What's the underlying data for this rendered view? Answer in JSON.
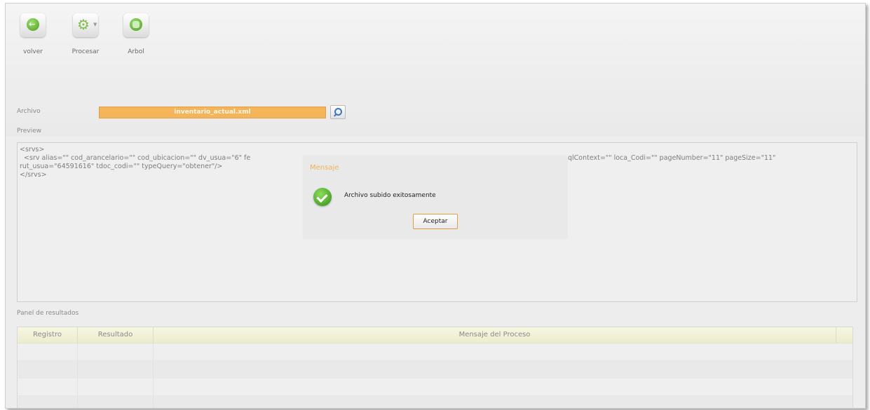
{
  "toolbar": {
    "back_label": "volver",
    "process_label": "Procesar",
    "tree_label": "Arbol"
  },
  "form": {
    "file_label": "Archivo",
    "file_value": "inventario_actual.xml",
    "preview_label": "Preview"
  },
  "preview": {
    "lines": [
      "<srvs>",
      "  <srv alias=\"\" cod_arancelario=\"\" cod_ubicacion=\"\" dv_usua=\"6\" fe",
      "rut_usua=\"64591616\" tdoc_codi=\"\" typeQuery=\"obtener\"/>",
      "</srvs>"
    ],
    "line2_tail": "qlContext=\"\" loca_Codi=\"\" pageNumber=\"11\" pageSize=\"11\""
  },
  "results": {
    "panel_label": "Panel de resultados",
    "columns": [
      "Registro",
      "Resultado",
      "Mensaje del Proceso"
    ]
  },
  "dialog": {
    "title": "Mensaje",
    "message": "Archivo subido exitosamente",
    "ok_label": "Aceptar"
  },
  "colors": {
    "accent_orange": "#f3b45a",
    "success_green": "#3fa52a"
  }
}
